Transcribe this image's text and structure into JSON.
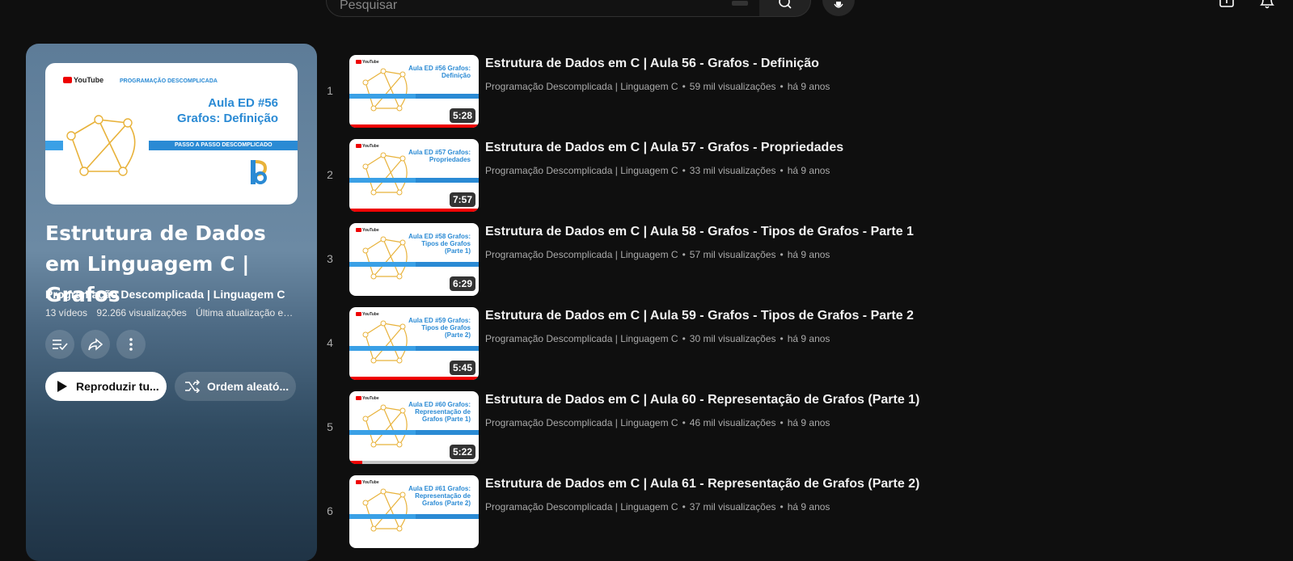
{
  "header": {
    "search_placeholder": "Pesquisar",
    "icons": [
      "search-icon",
      "microphone-icon",
      "create-icon",
      "bell-icon"
    ]
  },
  "playlist": {
    "hero_thumb": {
      "brand": "YouTube",
      "tag": "PROGRAMAÇÃO DESCOMPLICADA",
      "line1": "Aula ED #56",
      "line2": "Grafos: Definição",
      "banner": "PASSO A PASSO DESCOMPLICADO"
    },
    "title": "Estrutura de Dados em Linguagem C | Grafos",
    "channel": "Programação Descomplicada | Linguagem C",
    "video_count": "13 vídeos",
    "views": "92.266 visualizações",
    "updated": "Última atualização em ...",
    "play_all_label": "Reproduzir tu...",
    "shuffle_label": "Ordem aleató..."
  },
  "colors": {
    "background": "#0f0f0f",
    "progress": "#ff0000",
    "thumb_accent": "#2a8ad4",
    "graph": "#e8b23a"
  },
  "videos": [
    {
      "index": "1",
      "title": "Estrutura de Dados em C | Aula 56 - Grafos - Definição",
      "channel": "Programação Descomplicada | Linguagem C",
      "views": "59 mil visualizações",
      "age": "há 9 anos",
      "duration": "5:28",
      "watched": 1.0,
      "thumb_text": "Aula ED #56 Grafos: Definição"
    },
    {
      "index": "2",
      "title": "Estrutura de Dados em C | Aula 57 - Grafos - Propriedades",
      "channel": "Programação Descomplicada | Linguagem C",
      "views": "33 mil visualizações",
      "age": "há 9 anos",
      "duration": "7:57",
      "watched": 1.0,
      "thumb_text": "Aula ED #57 Grafos: Propriedades"
    },
    {
      "index": "3",
      "title": "Estrutura de Dados em C | Aula 58 - Grafos - Tipos de Grafos - Parte 1",
      "channel": "Programação Descomplicada | Linguagem C",
      "views": "57 mil visualizações",
      "age": "há 9 anos",
      "duration": "6:29",
      "watched": 0.0,
      "thumb_text": "Aula ED #58 Grafos: Tipos de Grafos (Parte 1)"
    },
    {
      "index": "4",
      "title": "Estrutura de Dados em C | Aula 59 - Grafos - Tipos de Grafos - Parte 2",
      "channel": "Programação Descomplicada | Linguagem C",
      "views": "30 mil visualizações",
      "age": "há 9 anos",
      "duration": "5:45",
      "watched": 1.0,
      "thumb_text": "Aula ED #59 Grafos: Tipos de Grafos (Parte 2)"
    },
    {
      "index": "5",
      "title": "Estrutura de Dados em C | Aula 60 - Representação de Grafos (Parte 1)",
      "channel": "Programação Descomplicada | Linguagem C",
      "views": "46 mil visualizações",
      "age": "há 9 anos",
      "duration": "5:22",
      "watched": 0.1,
      "thumb_text": "Aula ED #60 Grafos: Representação de Grafos (Parte 1)"
    },
    {
      "index": "6",
      "title": "Estrutura de Dados em C | Aula 61 - Representação de Grafos (Parte 2)",
      "channel": "Programação Descomplicada | Linguagem C",
      "views": "37 mil visualizações",
      "age": "há 9 anos",
      "duration": "",
      "watched": 0.0,
      "thumb_text": "Aula ED #61 Grafos: Representação de Grafos (Parte 2)"
    }
  ]
}
